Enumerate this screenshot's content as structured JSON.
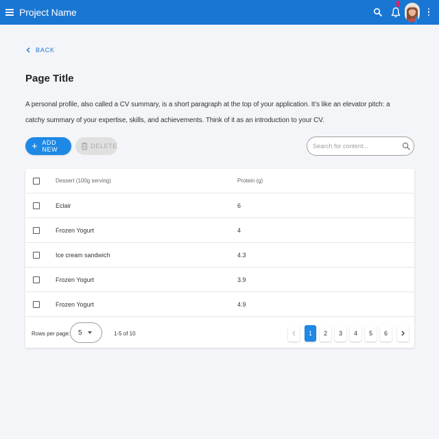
{
  "appbar": {
    "title": "Project Name",
    "icons": [
      "menu-icon",
      "search-icon",
      "bell-icon",
      "avatar",
      "more-vert-icon"
    ],
    "color": "#1976d2"
  },
  "back_label": "BACK",
  "page": {
    "title": "Page Title",
    "description": "A personal profile, also called a CV summary, is a short paragraph at the top of your application. It’s like an elevator pitch: a catchy summary of your expertise, skills, and achievements. Think of it as an introduction to your CV."
  },
  "toolbar": {
    "add_label": "ADD NEW",
    "delete_label": "DELETE",
    "search_placeholder": "Search for content..."
  },
  "table": {
    "columns": [
      "Dessert (100g serving)",
      "Protein (g)"
    ],
    "rows": [
      {
        "dessert": "Eclair",
        "protein": "6"
      },
      {
        "dessert": "Frozen Yogurt",
        "protein": "4"
      },
      {
        "dessert": "Ice cream sandwich",
        "protein": "4.3"
      },
      {
        "dessert": "Frozen Yogurt",
        "protein": "3.9"
      },
      {
        "dessert": "Frozen Yogurt",
        "protein": "4.9"
      }
    ]
  },
  "pagination": {
    "rows_per_page_label": "Rows per page:",
    "rows_per_page_value": "5",
    "range_text": "1-5 of 10",
    "pages": [
      "1",
      "2",
      "3",
      "4",
      "5",
      "6"
    ],
    "active_page": "1"
  }
}
